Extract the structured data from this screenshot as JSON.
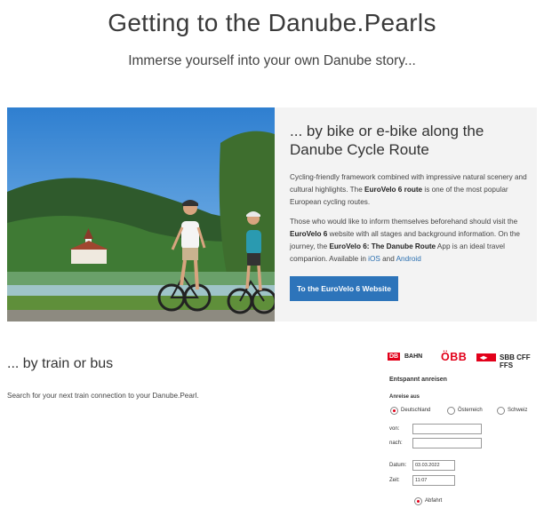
{
  "page": {
    "title": "Getting to the Danube.Pearls",
    "subtitle": "Immerse yourself into your own Danube story..."
  },
  "bike": {
    "heading": "... by bike or e-bike along the Danube Cycle Route",
    "para1_a": "Cycling-friendly framework combined with impressive natural scenery and cultural highlights. The ",
    "para1_b": "EuroVelo 6 route",
    "para1_c": " is one of the most popular European cycling routes.",
    "para2_a": "Those who would like to inform themselves beforehand should visit the ",
    "para2_b": "EuroVelo 6",
    "para2_c": " website with all stages and background information. On the journey, the ",
    "para2_d": "EuroVelo 6: The Danube Route",
    "para2_e": " App is an ideal travel companion. Available in ",
    "ios": "iOS",
    "and": " and ",
    "android": "Android",
    "button": "To the EuroVelo 6 Website"
  },
  "train": {
    "heading": "... by train or bus",
    "text": "Search for your next train connection to your Danube.Pearl."
  },
  "widget": {
    "logo_db": "DB",
    "logo_bahn": "BAHN",
    "logo_obb": "ÖBB",
    "logo_sbb_mark": "◂▸",
    "logo_sbb": "SBB CFF FFS",
    "title": "Entspannt anreisen",
    "anreise": "Anreise aus",
    "countries": [
      "Deutschland",
      "Österreich",
      "Schweiz"
    ],
    "von_label": "von:",
    "nach_label": "nach:",
    "datum_label": "Datum:",
    "datum_value": "03.03.2022",
    "zeit_label": "Zeit:",
    "zeit_value": "11:07",
    "abfahrt": "Abfahrt"
  }
}
